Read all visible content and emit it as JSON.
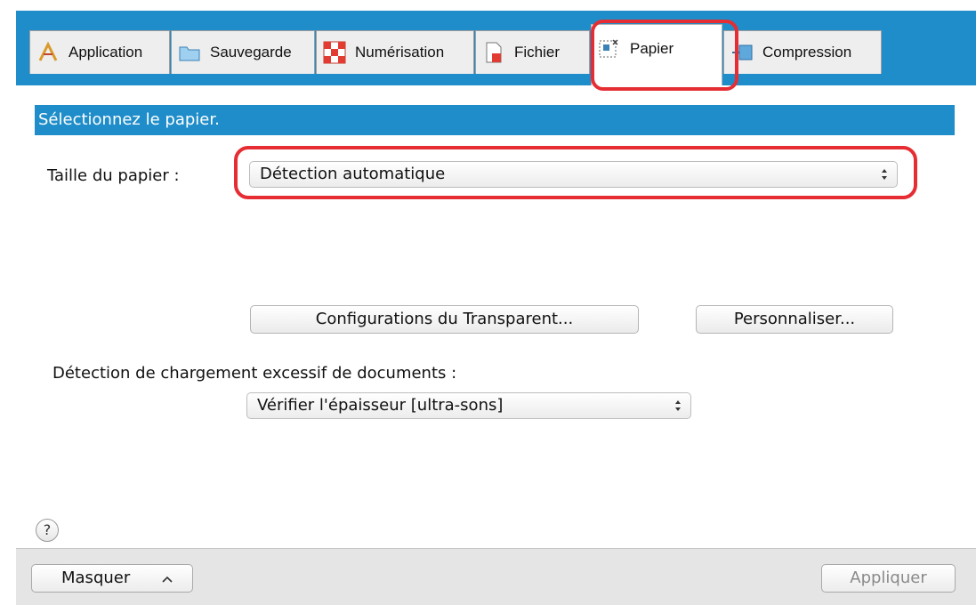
{
  "tabs": [
    {
      "label": "Application",
      "icon": "application-icon"
    },
    {
      "label": "Sauvegarde",
      "icon": "folder-icon"
    },
    {
      "label": "Numérisation",
      "icon": "scan-icon"
    },
    {
      "label": "Fichier",
      "icon": "file-icon"
    },
    {
      "label": "Papier",
      "icon": "paper-icon",
      "active": true
    },
    {
      "label": "Compression",
      "icon": "compression-icon"
    }
  ],
  "section": {
    "title": "Sélectionnez le papier."
  },
  "paper_size": {
    "label": "Taille du papier :",
    "value": "Détection automatique"
  },
  "buttons": {
    "transparent": "Configurations du Transparent...",
    "customize": "Personnaliser..."
  },
  "overload": {
    "label": "Détection de chargement excessif de documents :",
    "value": "Vérifier l'épaisseur [ultra-sons]"
  },
  "help": {
    "symbol": "?"
  },
  "footer": {
    "hide_label": "Masquer",
    "apply_label": "Appliquer"
  },
  "colors": {
    "accent": "#1f8dc9",
    "highlight": "#e52d33",
    "disabled_text": "#8a8a8a"
  }
}
